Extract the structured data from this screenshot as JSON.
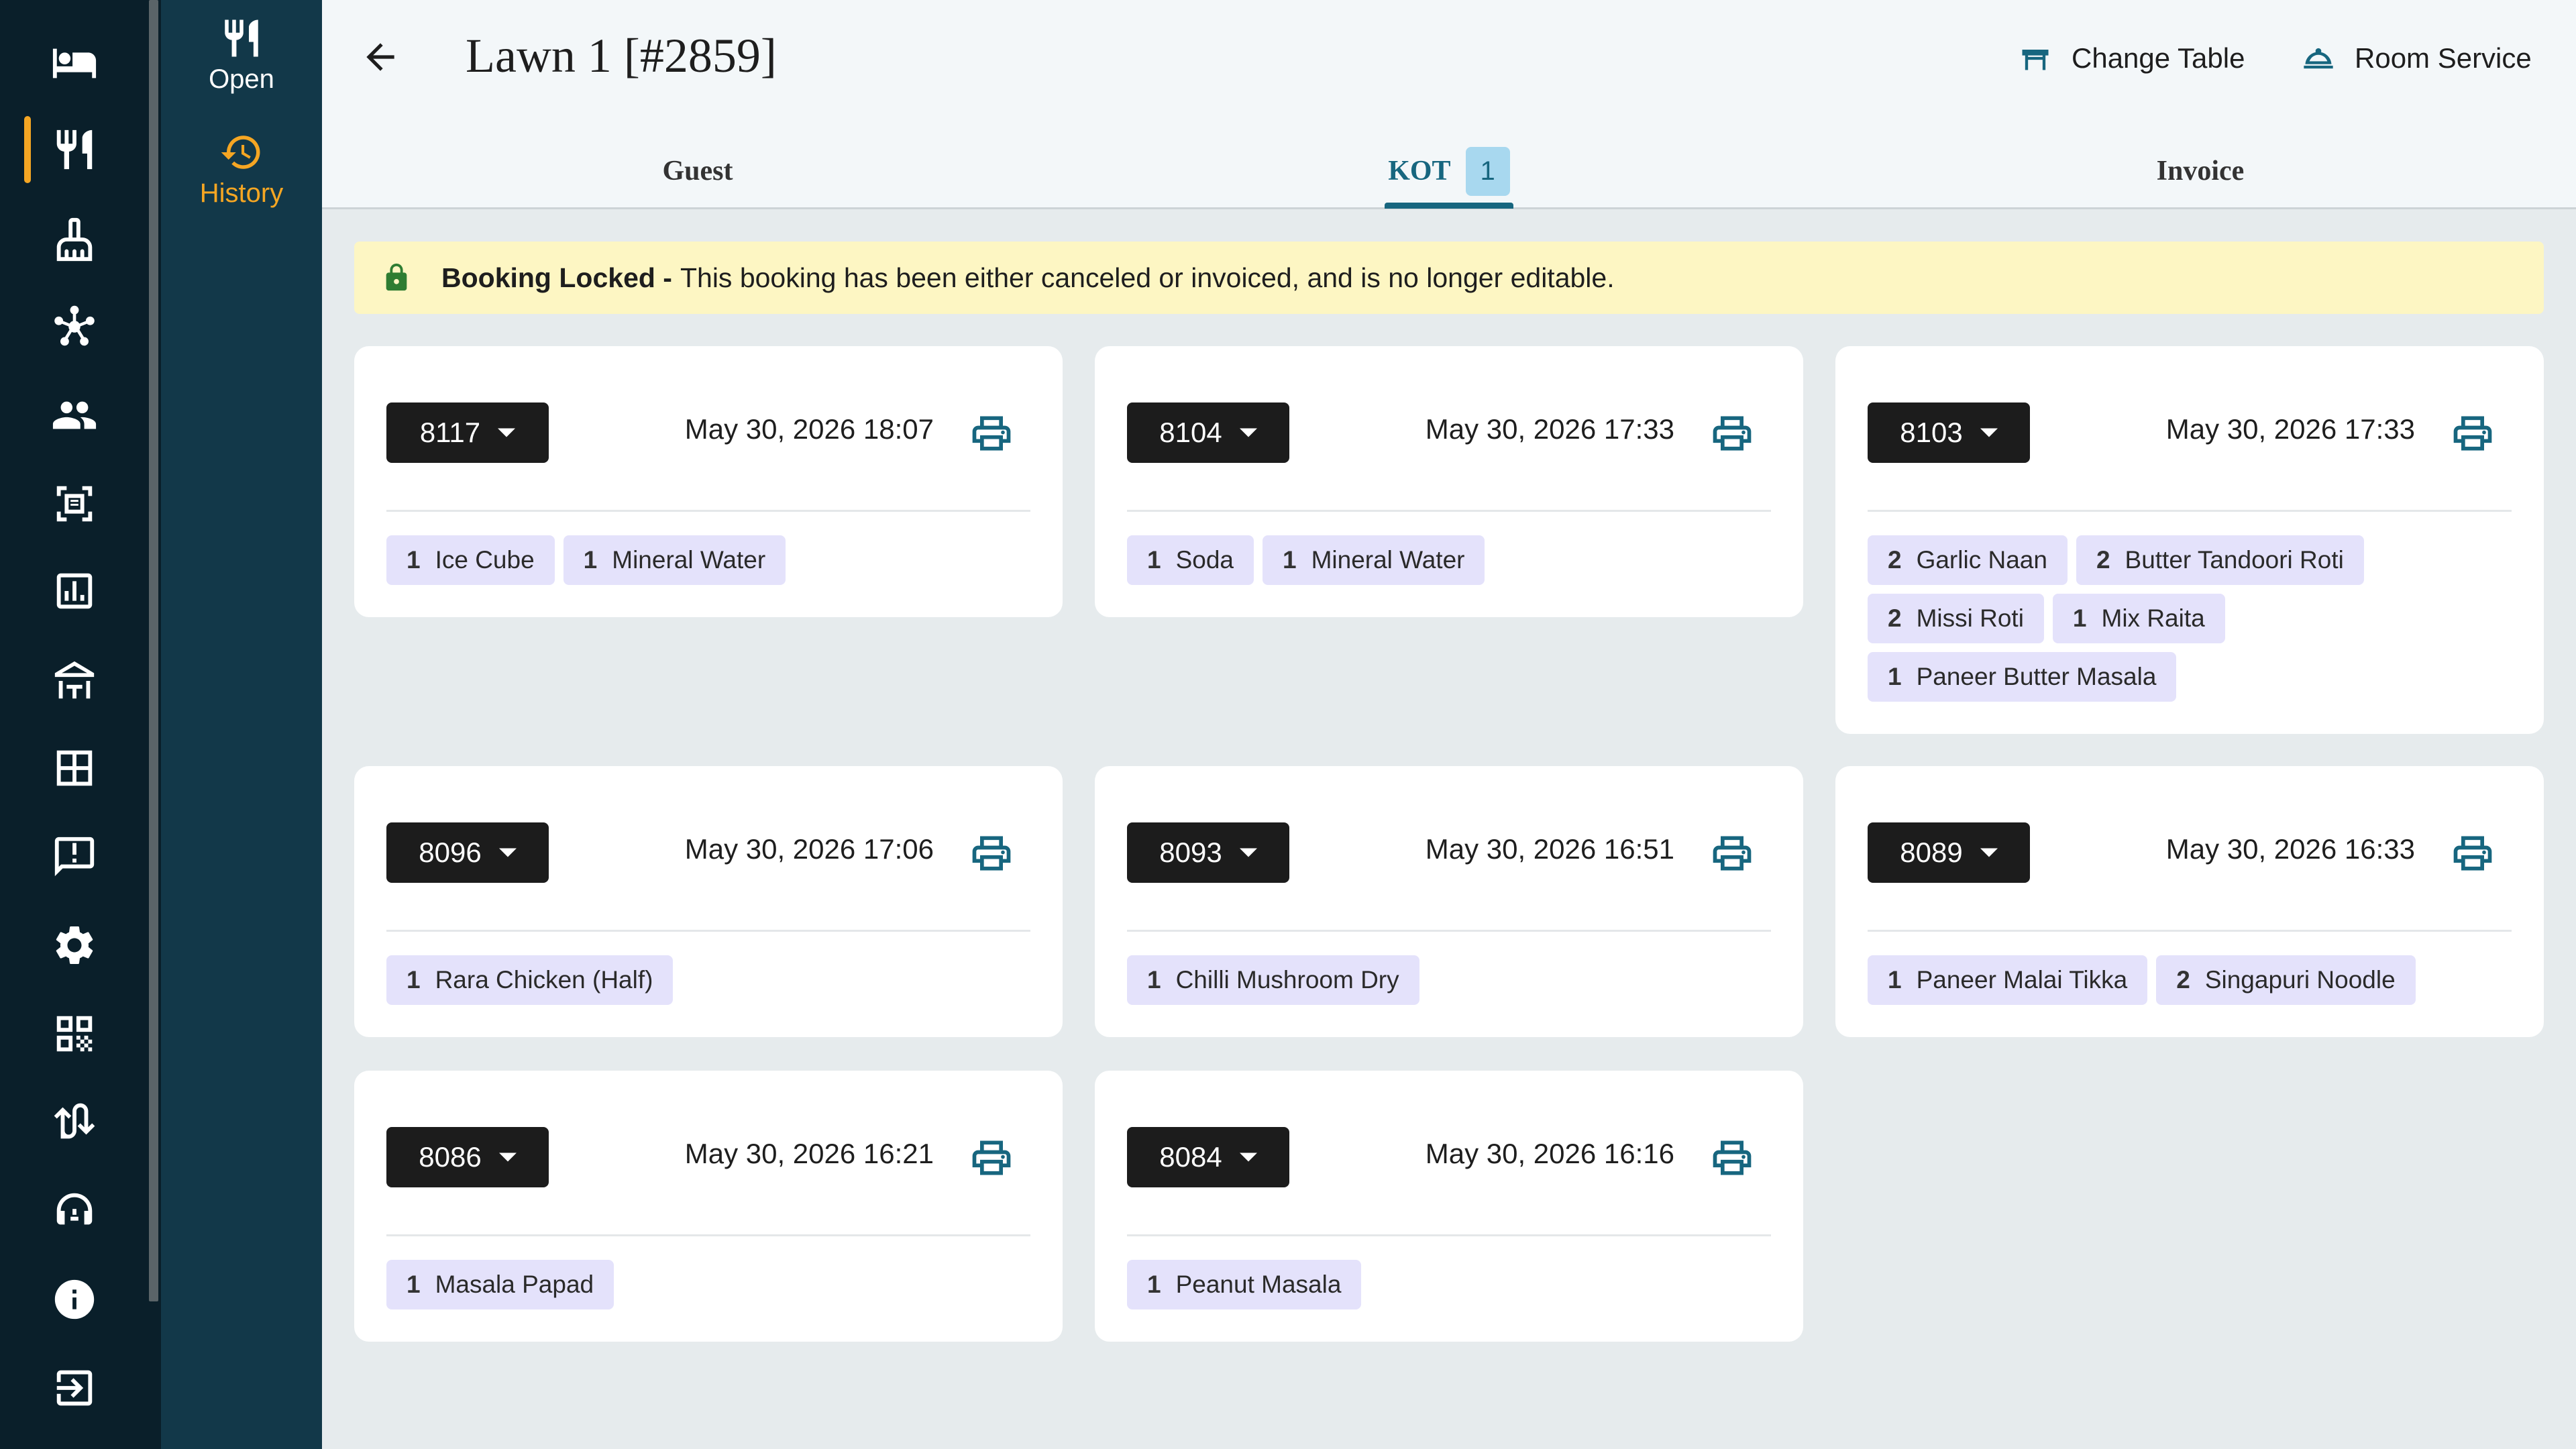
{
  "header": {
    "title": "Lawn 1 [#2859]",
    "change_table": "Change Table",
    "room_service": "Room Service"
  },
  "sidebar": {
    "items": [
      {
        "icon": "bed-icon"
      },
      {
        "icon": "restaurant-icon",
        "active": true
      },
      {
        "icon": "housekeeping-icon"
      },
      {
        "icon": "network-icon"
      },
      {
        "icon": "users-icon"
      },
      {
        "icon": "receipt-icon"
      },
      {
        "icon": "report-icon"
      },
      {
        "icon": "banquet-icon"
      },
      {
        "icon": "floor-plan-icon"
      },
      {
        "icon": "feedback-icon"
      },
      {
        "icon": "settings-icon"
      },
      {
        "icon": "qr-code-icon"
      },
      {
        "icon": "sync-icon"
      },
      {
        "icon": "support-icon"
      },
      {
        "icon": "info-icon"
      },
      {
        "icon": "logout-icon"
      }
    ],
    "accent": "#f5a623"
  },
  "subnav": {
    "open": "Open",
    "history": "History"
  },
  "tabs": {
    "guest": "Guest",
    "kot": "KOT",
    "kot_count": "1",
    "invoice": "Invoice"
  },
  "alert": {
    "title": "Booking Locked -",
    "message": "This booking has been either canceled or invoiced, and is no longer editable."
  },
  "kots": [
    {
      "number": "8117",
      "datetime": "May 30, 2026 18:07",
      "items": [
        {
          "qty": "1",
          "name": "Ice Cube"
        },
        {
          "qty": "1",
          "name": "Mineral Water"
        }
      ]
    },
    {
      "number": "8104",
      "datetime": "May 30, 2026 17:33",
      "items": [
        {
          "qty": "1",
          "name": "Soda"
        },
        {
          "qty": "1",
          "name": "Mineral Water"
        }
      ]
    },
    {
      "number": "8103",
      "datetime": "May 30, 2026 17:33",
      "items": [
        {
          "qty": "2",
          "name": "Garlic Naan"
        },
        {
          "qty": "2",
          "name": "Butter Tandoori Roti"
        },
        {
          "qty": "2",
          "name": "Missi Roti"
        },
        {
          "qty": "1",
          "name": "Mix Raita"
        },
        {
          "qty": "1",
          "name": "Paneer Butter Masala"
        }
      ]
    },
    {
      "number": "8096",
      "datetime": "May 30, 2026 17:06",
      "items": [
        {
          "qty": "1",
          "name": "Rara Chicken (Half)"
        }
      ]
    },
    {
      "number": "8093",
      "datetime": "May 30, 2026 16:51",
      "items": [
        {
          "qty": "1",
          "name": "Chilli Mushroom Dry"
        }
      ]
    },
    {
      "number": "8089",
      "datetime": "May 30, 2026 16:33",
      "items": [
        {
          "qty": "1",
          "name": "Paneer Malai Tikka"
        },
        {
          "qty": "2",
          "name": "Singapuri Noodle"
        }
      ]
    },
    {
      "number": "8086",
      "datetime": "May 30, 2026 16:21",
      "items": [
        {
          "qty": "1",
          "name": "Masala Papad"
        }
      ]
    },
    {
      "number": "8084",
      "datetime": "May 30, 2026 16:16",
      "items": [
        {
          "qty": "1",
          "name": "Peanut Masala"
        }
      ]
    }
  ],
  "colors": {
    "primary": "#17667f",
    "rail": "#0a1f2a",
    "subnav": "#123849",
    "chip": "#e4e2fb",
    "alert_bg": "#fdf6c3",
    "lock": "#2e7d32"
  }
}
